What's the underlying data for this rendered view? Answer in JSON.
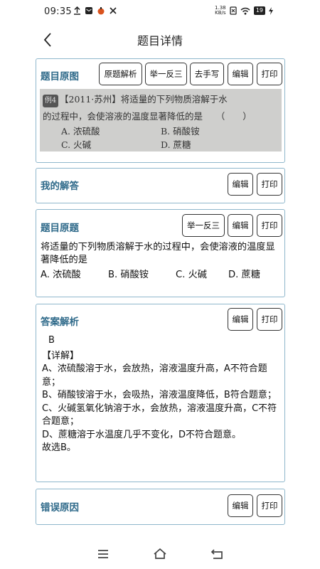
{
  "status_bar": {
    "time": "09:35",
    "left_icons": [
      "upload-icon",
      "mail-icon",
      "app-icon",
      "tools-icon"
    ],
    "net_speed": "1.38 KB/s",
    "battery": "19"
  },
  "header": {
    "title": "题目详情"
  },
  "original_image_card": {
    "title": "题目原图",
    "buttons": {
      "analysis": "原题解析",
      "similar": "举一反三",
      "remove_handwriting": "去手写",
      "edit": "编辑",
      "print": "打印"
    },
    "photo": {
      "badge": "例4",
      "line1": "【2011·苏州】将适量的下列物质溶解于水",
      "line2": "的过程中，会使溶液的温度显著降低的是　　（　　）",
      "opt_a": "A. 浓硫酸",
      "opt_b": "B. 硝酸铵",
      "opt_c": "C. 火碱",
      "opt_d": "D. 蔗糖"
    }
  },
  "my_answer_card": {
    "title": "我的解答",
    "buttons": {
      "edit": "编辑",
      "print": "打印"
    }
  },
  "question_card": {
    "title": "题目原题",
    "buttons": {
      "similar": "举一反三",
      "edit": "编辑",
      "print": "打印"
    },
    "text": "将适量的下列物质溶解于水的过程中，会使溶液的温度显著降低的是",
    "options": {
      "a": "A. 浓硫酸",
      "b": "B. 硝酸铵",
      "c": "C. 火碱",
      "d": "D. 蔗糖"
    }
  },
  "answer_card": {
    "title": "答案解析",
    "buttons": {
      "edit": "编辑",
      "print": "打印"
    },
    "answer": "B",
    "detail_heading": "【详解】",
    "lines": [
      "A、浓硫酸溶于水，会放热，溶液温度升高，A不符合题意；",
      "B、硝酸铵溶于水，会吸热，溶液温度降低，B符合题意；",
      "C、火碱氢氧化钠溶于水，会放热，溶液温度升高，C不符合题意；",
      "D、蔗糖溶于水温度几乎不变化，D不符合题意。",
      "故选B。"
    ]
  },
  "error_card": {
    "title": "错误原因",
    "buttons": {
      "edit": "编辑",
      "print": "打印"
    }
  },
  "nav_bar": {
    "icons": [
      "menu-icon",
      "home-icon",
      "back-nav-icon"
    ]
  },
  "colors": {
    "accent_title": "#2f6a8a",
    "card_border": "#8fb7cc"
  }
}
